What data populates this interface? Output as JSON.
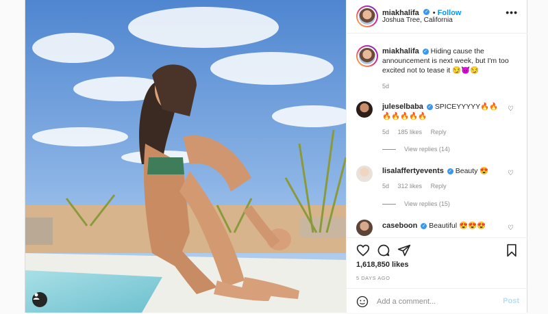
{
  "post": {
    "username": "miakhalifa",
    "follow_label": "Follow",
    "location": "Joshua Tree, California",
    "more_label": "•••"
  },
  "caption": {
    "username": "miakhalifa",
    "text": "Hiding cause the announcement is next week, but I'm too excited not to tease it 😏😈😏",
    "age": "5d"
  },
  "comments": [
    {
      "username": "juleselbaba",
      "text": "SPICEYYYYY🔥🔥🔥🔥🔥🔥🔥",
      "age": "5d",
      "likes": "185 likes",
      "reply_label": "Reply",
      "view_replies": "View replies (14)"
    },
    {
      "username": "lisalaffertyevents",
      "text": "Beauty 😍",
      "age": "5d",
      "likes": "312 likes",
      "reply_label": "Reply",
      "view_replies": "View replies (15)"
    },
    {
      "username": "caseboon",
      "text": "Beautiful 😍😍😍"
    }
  ],
  "stats": {
    "likes": "1,618,850 likes",
    "date": "5 DAYS AGO"
  },
  "composer": {
    "placeholder": "Add a comment...",
    "post_label": "Post"
  },
  "icons": {
    "verified": "✓"
  }
}
